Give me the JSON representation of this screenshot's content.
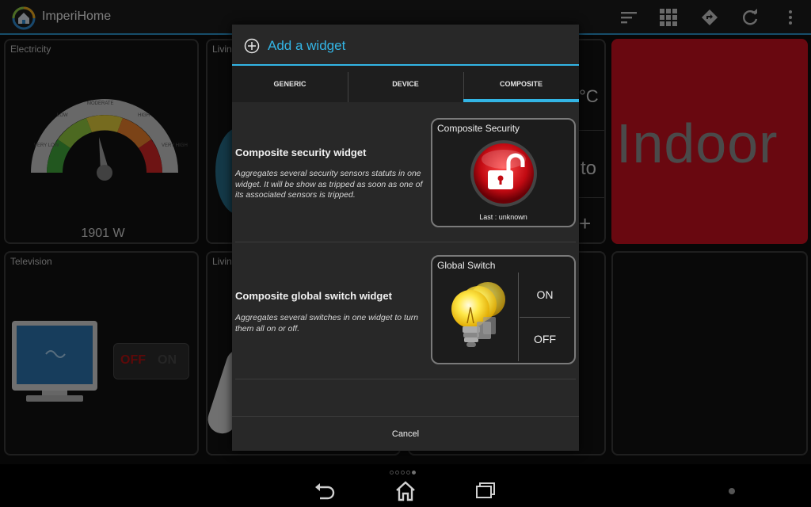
{
  "app": {
    "title": "ImperiHome"
  },
  "tiles": {
    "electricity": {
      "title": "Electricity",
      "gauge_labels": [
        "VERY LOW",
        "LOW",
        "MODERATE",
        "HIGH",
        "VERY HIGH"
      ],
      "value": "1901 W"
    },
    "living1": {
      "title": "Livin"
    },
    "temp": {
      "unit": "°C",
      "partial": "to",
      "plus": "+"
    },
    "indoor": {
      "label": "Indoor"
    },
    "television": {
      "title": "Television",
      "switch_off": "OFF",
      "switch_on": "ON"
    },
    "living2": {
      "title": "Livin"
    }
  },
  "dialog": {
    "title": "Add a widget",
    "tabs": [
      {
        "label": "GENERIC",
        "selected": false
      },
      {
        "label": "DEVICE",
        "selected": false
      },
      {
        "label": "COMPOSITE",
        "selected": true
      }
    ],
    "rows": [
      {
        "title": "Composite security widget",
        "description": "Aggregates several security sensors statuts in one widget. It will be show as tripped as soon as one of its associated sensors is tripped.",
        "preview_title": "Composite Security",
        "preview_caption": "Last : unknown"
      },
      {
        "title": "Composite global switch widget",
        "description": "Aggregates several switches in one widget to turn them all on or off.",
        "preview_title": "Global Switch",
        "on_label": "ON",
        "off_label": "OFF"
      }
    ],
    "cancel_label": "Cancel"
  },
  "colors": {
    "accent": "#33b5e5",
    "indoor_tile": "#c0101e",
    "alarm_red": "#d4101c"
  },
  "page_dots": {
    "count": 5,
    "active_index": 4
  }
}
